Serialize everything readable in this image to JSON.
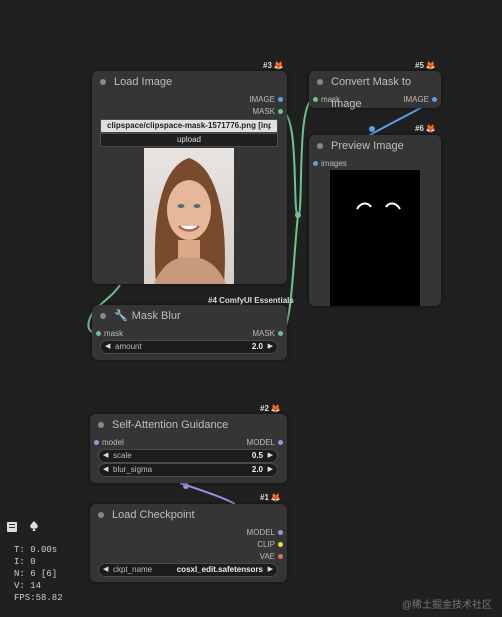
{
  "nodes": {
    "load_image": {
      "id": "#3",
      "title": "Load Image",
      "outputs": [
        "IMAGE",
        "MASK"
      ],
      "file_value": "clipspace/clipspace-mask-1571776.png [input]",
      "upload_label": "upload"
    },
    "convert_mask": {
      "id": "#5",
      "title": "Convert Mask to Image",
      "input": "mask",
      "output": "IMAGE"
    },
    "preview_image": {
      "id": "#6",
      "title": "Preview Image",
      "input": "images"
    },
    "mask_blur": {
      "id": "#4",
      "group_label": "#4 ComfyUI Essentials",
      "title": "Mask Blur",
      "input": "mask",
      "output": "MASK",
      "widget": {
        "label": "amount",
        "value": "2.0"
      }
    },
    "sag": {
      "id": "#2",
      "title": "Self-Attention Guidance",
      "input": "model",
      "output": "MODEL",
      "widgets": [
        {
          "label": "scale",
          "value": "0.5"
        },
        {
          "label": "blur_sigma",
          "value": "2.0"
        }
      ]
    },
    "checkpoint": {
      "id": "#1",
      "title": "Load Checkpoint",
      "outputs": [
        "MODEL",
        "CLIP",
        "VAE"
      ],
      "widget": {
        "label": "ckpt_name",
        "value": "cosxl_edit.safetensors"
      }
    }
  },
  "stats": {
    "t": "T: 0.00s",
    "i": "I: 0",
    "n": "N: 6 [6]",
    "v": "V: 14",
    "fps": "FPS:58.82"
  },
  "watermark": "@稀土掘金技术社区",
  "colors": {
    "mask_link": "#6fc18e",
    "image_link": "#5aa2e8",
    "model_link": "#9a92e6"
  }
}
